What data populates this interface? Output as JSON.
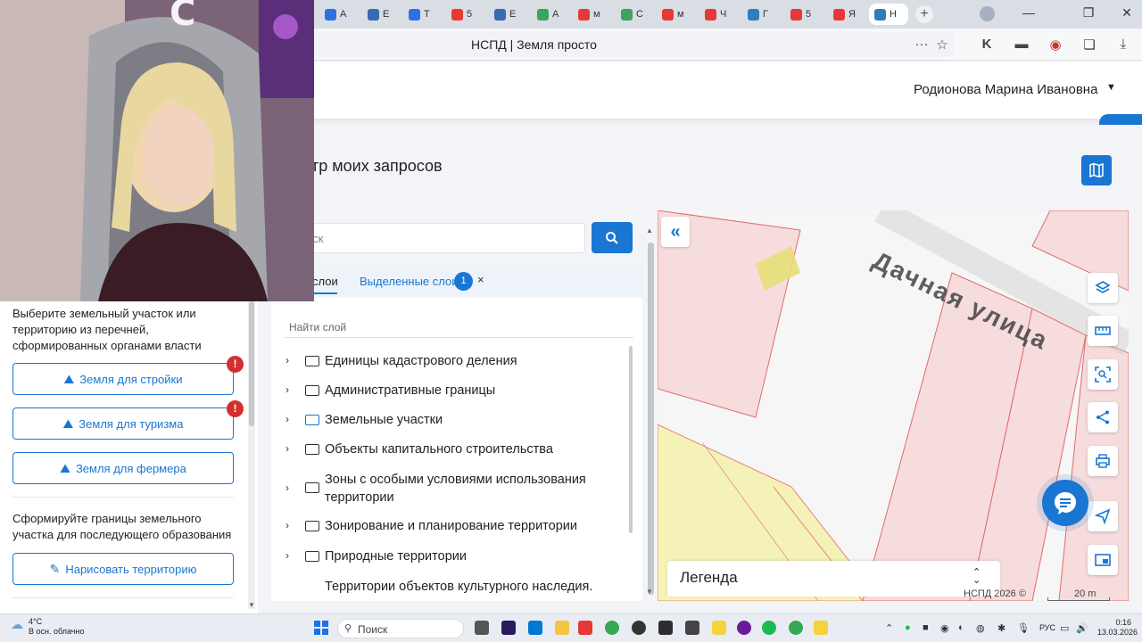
{
  "browser": {
    "tabs": [
      {
        "label": "А",
        "color": "#2f6fe4"
      },
      {
        "label": "Е",
        "color": "#3a6ab0"
      },
      {
        "label": "Т",
        "color": "#2f6fe4"
      },
      {
        "label": "5",
        "color": "#e53935"
      },
      {
        "label": "Е",
        "color": "#3a6ab0"
      },
      {
        "label": "А",
        "color": "#3aa55b"
      },
      {
        "label": "м",
        "color": "#e53935"
      },
      {
        "label": "С",
        "color": "#3aa55b"
      },
      {
        "label": "м",
        "color": "#e53935"
      },
      {
        "label": "Ч",
        "color": "#e53935"
      },
      {
        "label": "Г",
        "color": "#2e7dbd"
      },
      {
        "label": "5",
        "color": "#e53935"
      },
      {
        "label": "Я",
        "color": "#e53935"
      },
      {
        "label": "Н",
        "color": "#2e7dbd"
      }
    ],
    "new_tab": "+",
    "window_controls": {
      "minimize": "—",
      "restore": "❐",
      "close": "✕"
    },
    "page_title": "НСПД | Земля просто",
    "address_icons": [
      "more-icon",
      "bookmark-icon",
      "extension-icon",
      "reader-icon",
      "shield-icon",
      "collections-icon",
      "download-icon"
    ],
    "address_glyphs": {
      "more": "···",
      "bookmark": "☆",
      "download": "⤓"
    }
  },
  "header": {
    "user_name": "Родионова Марина Ивановна",
    "caret": "▼"
  },
  "page": {
    "title": "естр моих запросов"
  },
  "sidebar": {
    "intro_text": "Выберите земельный участок или территорию из перечней, сформированных органами власти",
    "buttons": [
      {
        "label": "Земля для стройки",
        "alert": "!"
      },
      {
        "label": "Земля для туризма",
        "alert": "!"
      },
      {
        "label": "Земля для фермера",
        "alert": ""
      }
    ],
    "draw_text": "Сформируйте границы земельного участка для последующего образования",
    "draw_button": "Нарисовать территорию"
  },
  "search": {
    "placeholder": "иск"
  },
  "layer_tabs": {
    "layers": "слои",
    "selected": "Выделенные слои",
    "selected_count": "1",
    "close": "×"
  },
  "layers": {
    "find_label": "Найти слой",
    "items": [
      {
        "label": "Единицы кадастрового деления"
      },
      {
        "label": "Административные границы"
      },
      {
        "label": "Земельные участки"
      },
      {
        "label": "Объекты капитального строительства"
      },
      {
        "label": "Зоны с особыми условиями использования территории"
      },
      {
        "label": "Зонирование и планирование территории"
      },
      {
        "label": "Природные территории"
      },
      {
        "label": "Территории объектов культурного наследия."
      }
    ]
  },
  "map": {
    "street_label": "Дачная улица",
    "legend": "Легенда",
    "copyright": "НСПД 2026 ©",
    "scale": "20 m",
    "collapse": "«",
    "colors": {
      "parcel_fill": "#f6dcdc",
      "parcel_stroke": "#e26a6a",
      "zone_fill": "#f5f2b8",
      "building_fill": "#e6df78"
    }
  },
  "taskbar": {
    "weather_temp": "4°C",
    "weather_desc": "В осн. облачно",
    "search": "Поиск",
    "lang": "РУС",
    "time": "0:16",
    "date": "13.03.2026"
  }
}
